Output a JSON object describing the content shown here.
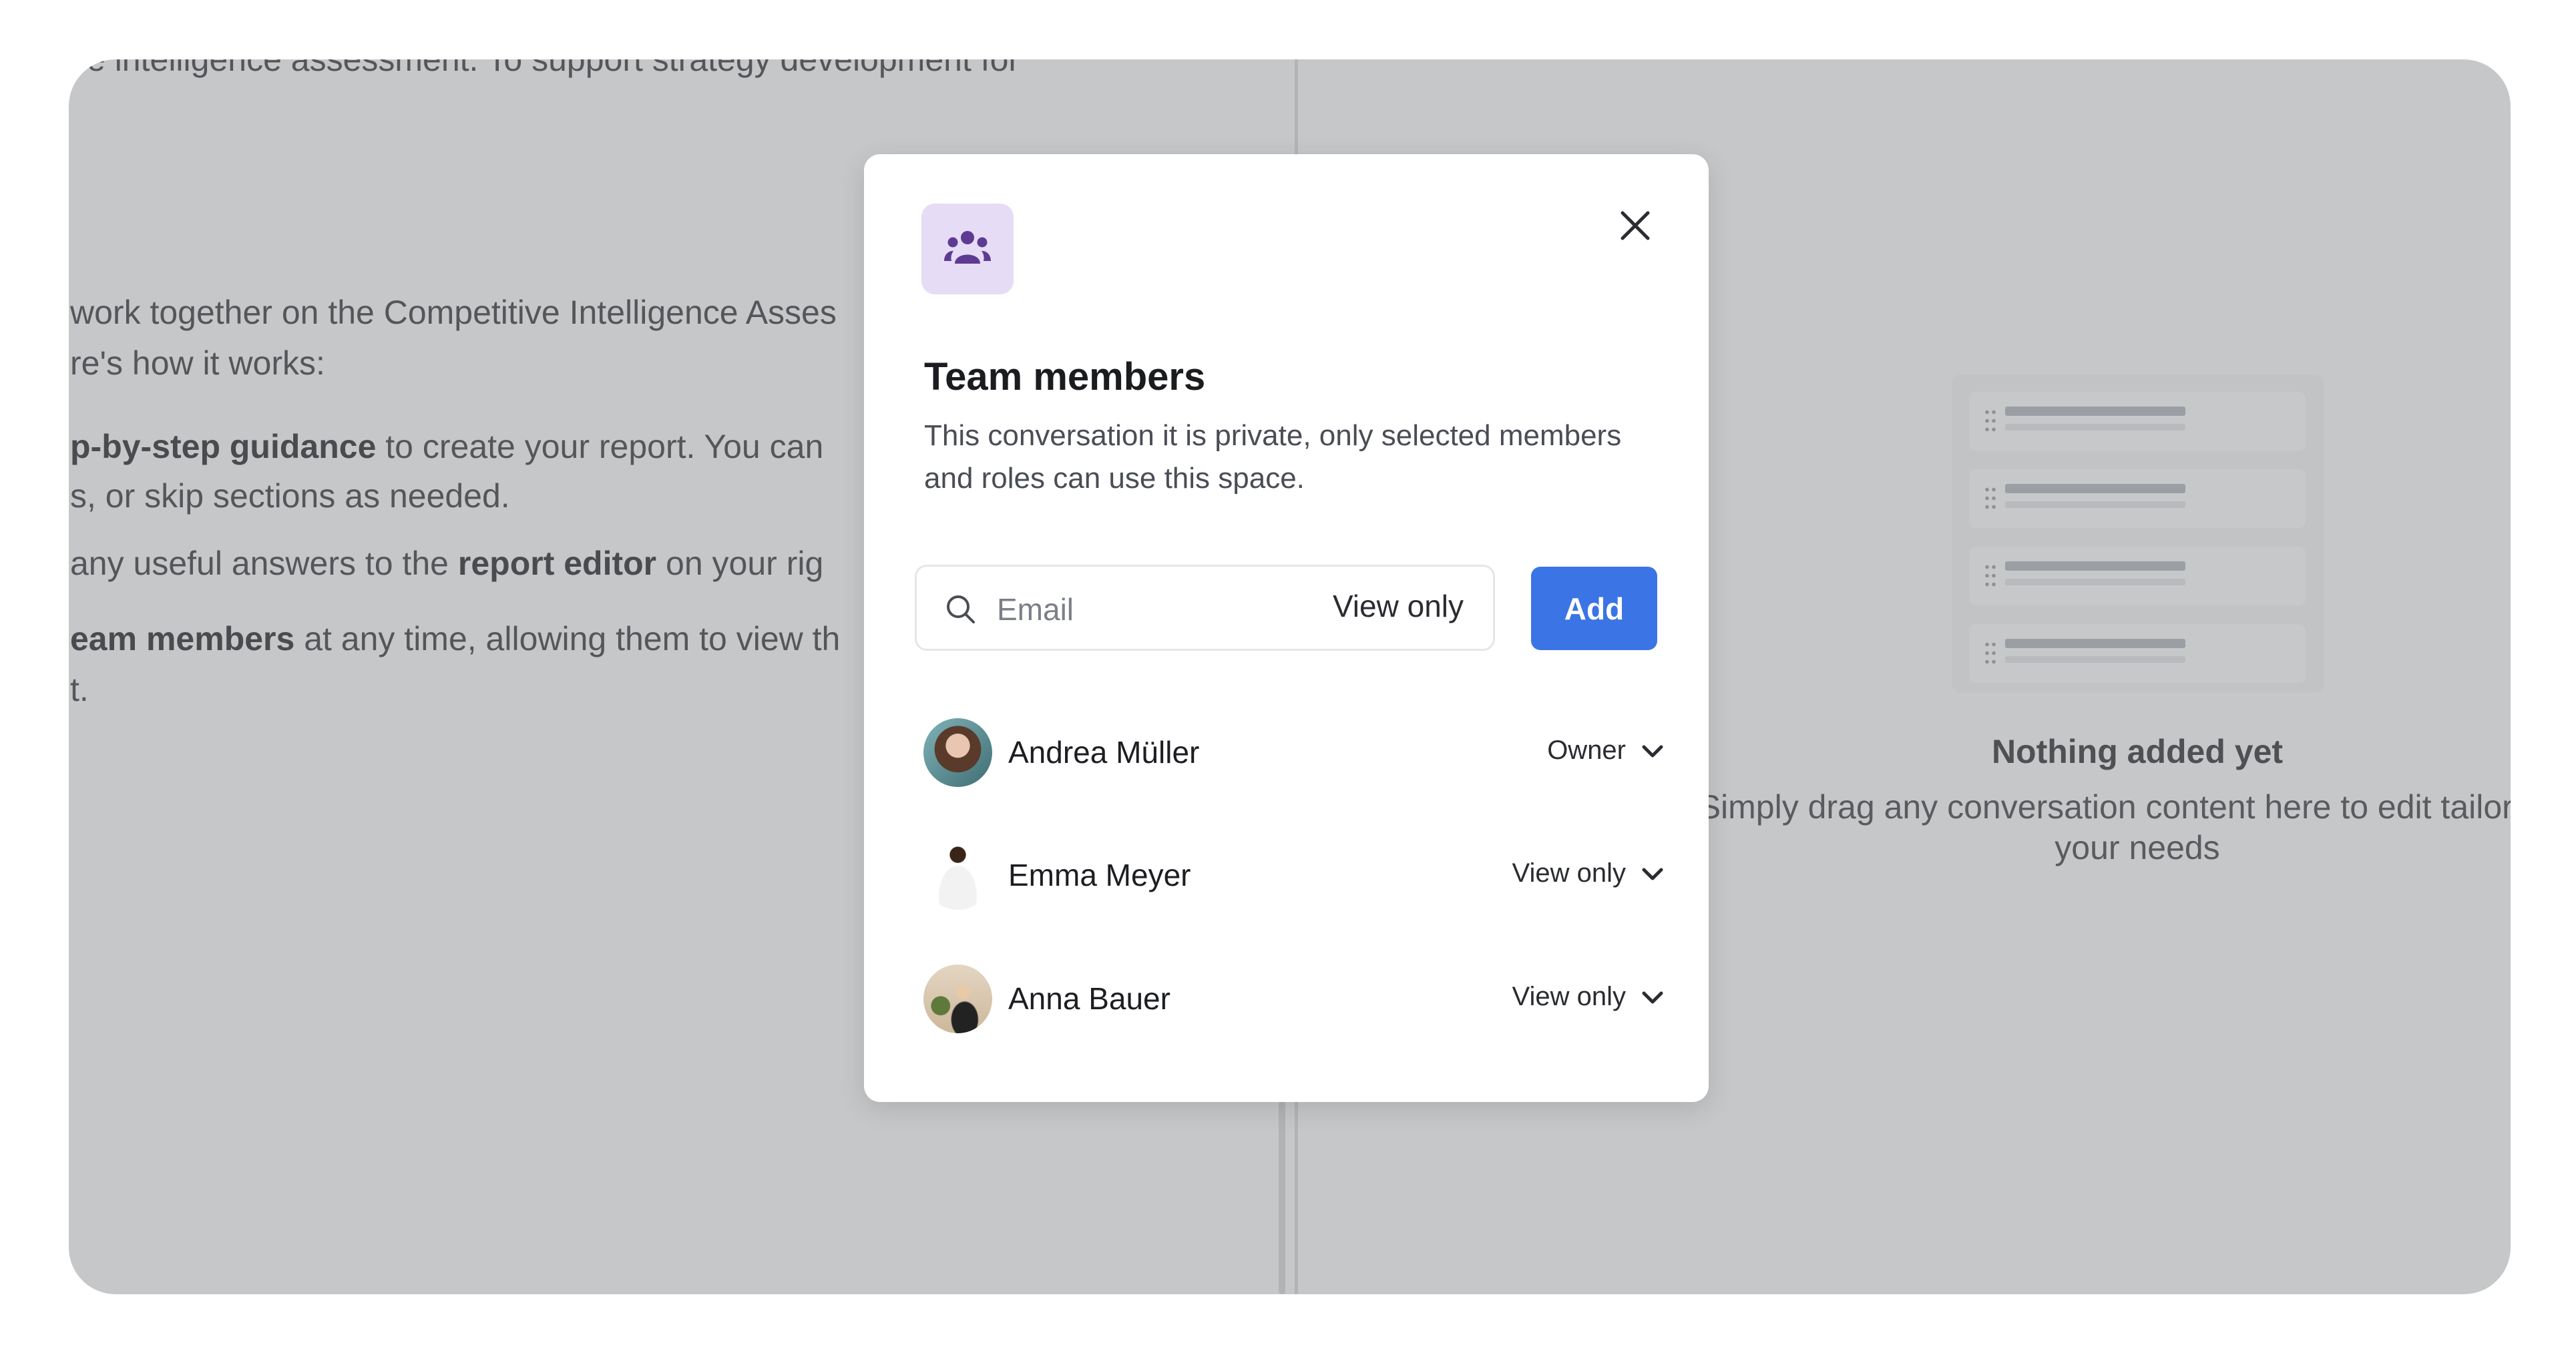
{
  "background_document": {
    "lines": [
      {
        "text": "ve intelligence assessment. To support strategy development for"
      },
      {
        "text": "work together on the Competitive Intelligence Asses"
      },
      {
        "text": "re's how it works:"
      },
      {
        "bold": "p-by-step guidance",
        "text": " to create your report. You can"
      },
      {
        "text": "s, or skip sections as needed."
      },
      {
        "pre": " any useful answers to the ",
        "bold": "report editor",
        "text": " on your rig"
      },
      {
        "bold": "eam members",
        "text": " at any time, allowing them to view th"
      },
      {
        "text": "t."
      }
    ]
  },
  "report_panel": {
    "empty_title": "Nothing added yet",
    "empty_subtitle": "Simply drag any conversation content here to edit tailor it to your needs"
  },
  "modal": {
    "icon": "team-icon",
    "close_icon": "close-icon",
    "title": "Team members",
    "description": "This conversation it is private, only selected members and roles can use this space.",
    "email_placeholder": "Email",
    "permission": "View only",
    "add_label": "Add",
    "accent_color": "#3b74e4",
    "members": [
      {
        "name": "Andrea Müller",
        "role": "Owner"
      },
      {
        "name": "Emma Meyer",
        "role": "View only"
      },
      {
        "name": "Anna Bauer",
        "role": "View only"
      }
    ]
  }
}
